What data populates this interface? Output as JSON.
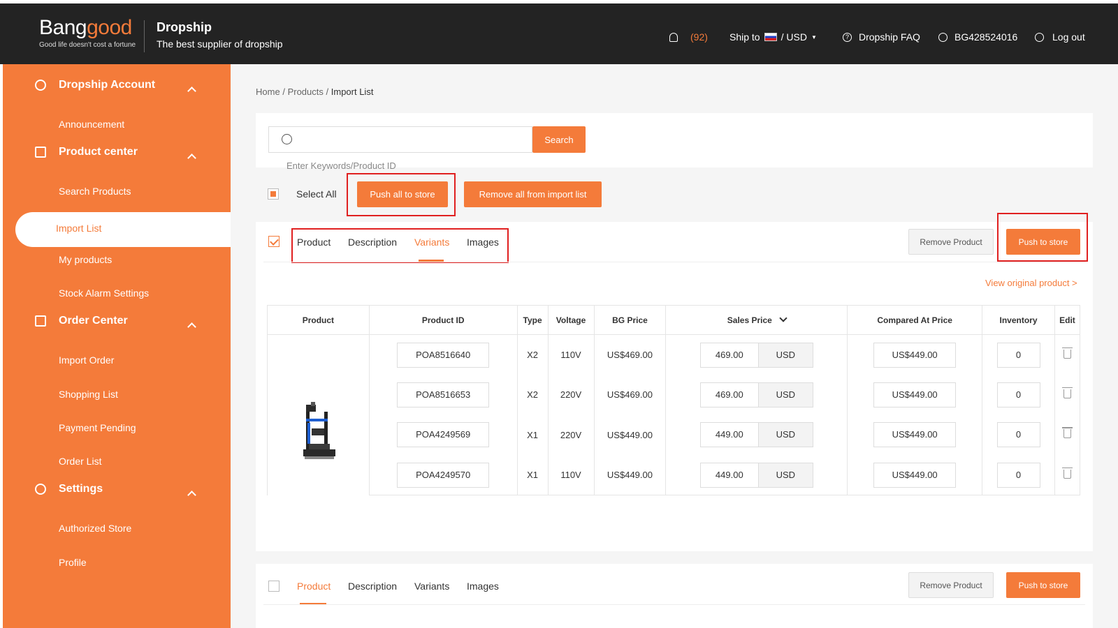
{
  "header": {
    "logo_a": "Bang",
    "logo_b": "good",
    "logo_tagline": "Good life doesn't cost a fortune",
    "brand_title": "Dropship",
    "brand_subtitle": "The best supplier of dropship",
    "notif_count": "(92)",
    "ship_to": "Ship to",
    "currency": "/ USD",
    "faq": "Dropship FAQ",
    "account_id": "BG428524016",
    "logout": "Log out"
  },
  "sidebar": {
    "sections": [
      {
        "label": "Dropship Account",
        "items": [
          "Announcement"
        ]
      },
      {
        "label": "Product center",
        "items": [
          "Search Products",
          "Import List",
          "My products",
          "Stock Alarm Settings"
        ]
      },
      {
        "label": "Order Center",
        "items": [
          "Import Order",
          "Shopping List",
          "Payment Pending",
          "Order List"
        ]
      },
      {
        "label": "Settings",
        "items": [
          "Authorized Store",
          "Profile"
        ]
      }
    ]
  },
  "breadcrumb": {
    "home": "Home",
    "sep1": "/",
    "products": "Products",
    "sep2": "/",
    "current": "Import List"
  },
  "search": {
    "button": "Search",
    "placeholder": "",
    "hint": "Enter Keywords/Product ID"
  },
  "bulk": {
    "select_all": "Select All",
    "push_all": "Push all to store",
    "remove_all": "Remove all from import list"
  },
  "product1": {
    "tabs": [
      "Product",
      "Description",
      "Variants",
      "Images"
    ],
    "active_tab": "Variants",
    "remove": "Remove Product",
    "push": "Push to store",
    "view_original": "View original product >",
    "columns": [
      "Product",
      "Product ID",
      "Type",
      "Voltage",
      "BG Price",
      "Sales Price",
      "Compared At Price",
      "Inventory",
      "Edit"
    ],
    "rows": [
      {
        "id": "POA8516640",
        "type": "X2",
        "voltage": "110V",
        "bg_price": "US$469.00",
        "sales": "469.00",
        "currency": "USD",
        "compared": "US$449.00",
        "inventory": "0"
      },
      {
        "id": "POA8516653",
        "type": "X2",
        "voltage": "220V",
        "bg_price": "US$469.00",
        "sales": "469.00",
        "currency": "USD",
        "compared": "US$449.00",
        "inventory": "0"
      },
      {
        "id": "POA4249569",
        "type": "X1",
        "voltage": "220V",
        "bg_price": "US$449.00",
        "sales": "449.00",
        "currency": "USD",
        "compared": "US$449.00",
        "inventory": "0"
      },
      {
        "id": "POA4249570",
        "type": "X1",
        "voltage": "110V",
        "bg_price": "US$449.00",
        "sales": "449.00",
        "currency": "USD",
        "compared": "US$449.00",
        "inventory": "0"
      }
    ]
  },
  "product2": {
    "tabs": [
      "Product",
      "Description",
      "Variants",
      "Images"
    ],
    "active_tab": "Product",
    "remove": "Remove Product",
    "push": "Push to store"
  },
  "colors": {
    "accent": "#f47b3a",
    "header_bg": "#232323",
    "highlight": "#e02020"
  }
}
